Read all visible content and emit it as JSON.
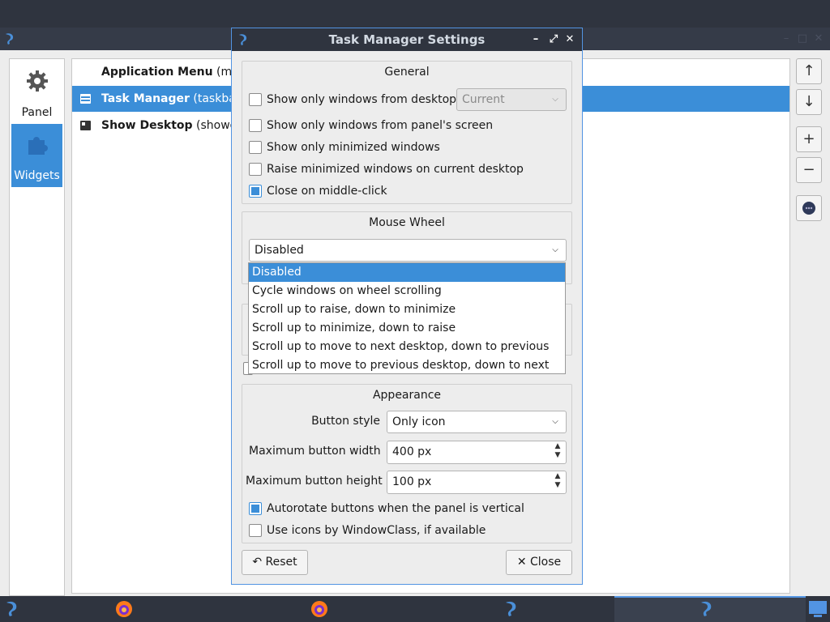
{
  "background_window": {
    "nav": [
      {
        "label": "Panel",
        "icon": "gear-icon"
      },
      {
        "label": "Widgets",
        "icon": "puzzle-icon"
      }
    ],
    "plugins": [
      {
        "name": "Application Menu",
        "suffix": "(mai"
      },
      {
        "name": "Task Manager",
        "suffix": "(taskbar)"
      },
      {
        "name": "Show Desktop",
        "suffix": "(showde"
      }
    ],
    "right_buttons": [
      "move-up",
      "move-down",
      "add",
      "remove",
      "configure"
    ]
  },
  "dialog": {
    "title": "Task Manager Settings",
    "general": {
      "title": "General",
      "show_only_desktop": {
        "label": "Show only windows from desktop",
        "checked": false
      },
      "desktop_combo": "Current",
      "show_only_screen": {
        "label": "Show only windows from panel's screen",
        "checked": false
      },
      "show_only_minimized": {
        "label": "Show only minimized windows",
        "checked": false
      },
      "raise_minimized": {
        "label": "Raise minimized windows on current desktop",
        "checked": false
      },
      "close_middle": {
        "label": "Close on middle-click",
        "checked": true
      }
    },
    "mouse_wheel": {
      "title": "Mouse Wheel",
      "selected": "Disabled",
      "options": [
        "Disabled",
        "Cycle windows on wheel scrolling",
        "Scroll up to raise, down to minimize",
        "Scroll up to minimize, down to raise",
        "Scroll up to move to next desktop, down to previous",
        "Scroll up to move to previous desktop, down to next"
      ]
    },
    "appearance": {
      "title": "Appearance",
      "button_style_label": "Button style",
      "button_style_value": "Only icon",
      "max_width_label": "Maximum button width",
      "max_width_value": "400 px",
      "max_height_label": "Maximum button height",
      "max_height_value": "100 px",
      "autorotate": {
        "label": "Autorotate buttons when the panel is vertical",
        "checked": true
      },
      "window_class": {
        "label": "Use icons by WindowClass, if available",
        "checked": false
      }
    },
    "reset_label": "Reset",
    "close_label": "Close"
  },
  "colors": {
    "accent": "#3b8ed8",
    "titlebar": "#2f343f",
    "dialog_bg": "#ededed"
  }
}
